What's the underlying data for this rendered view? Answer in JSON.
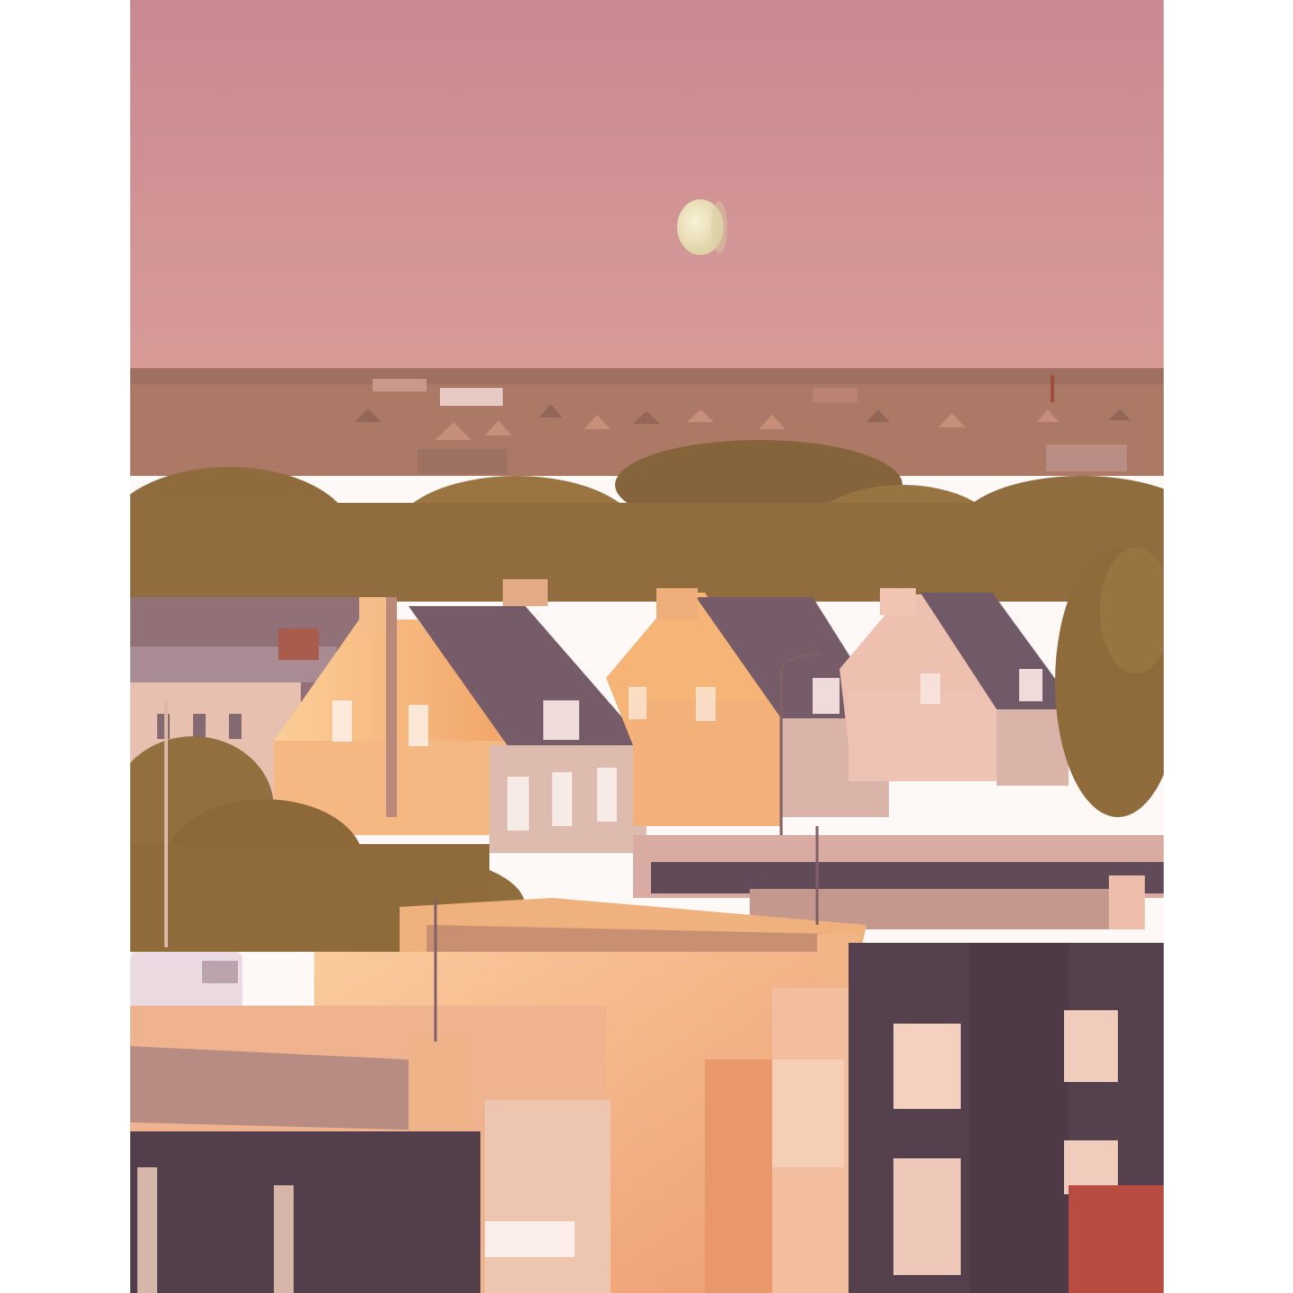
{
  "photo": {
    "subject": "moon-over-suburban-rooftops-at-golden-hour",
    "palette": {
      "sky_top": "#c98a94",
      "sky_bottom": "#d49a9a",
      "moon": "#f2efc8",
      "lit_wall": "#f2b98a",
      "sunlit_gable": "#f9c98c",
      "roof_slate": "#6e5a68",
      "dark_cladding": "#4b3c4a",
      "trees": "#8a6a3c",
      "distant_town": "#a77866",
      "frame": "#ffffff"
    }
  }
}
